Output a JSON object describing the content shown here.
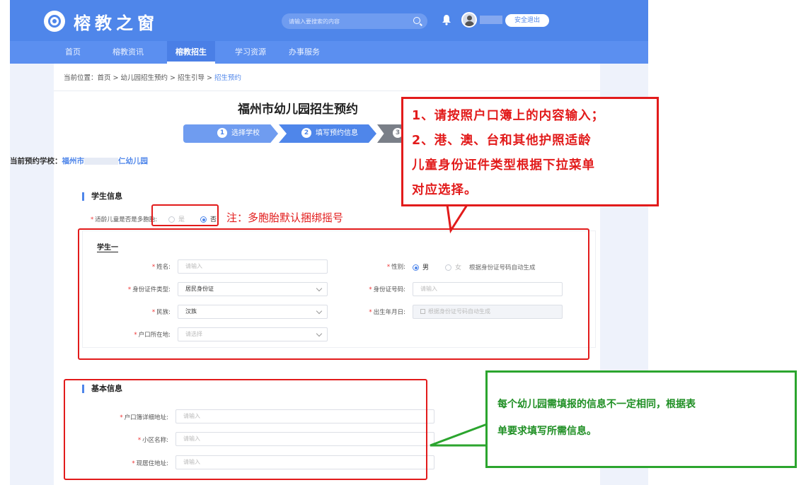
{
  "header": {
    "logo_text": "榕教之窗",
    "search_placeholder": "请输入要搜索的内容",
    "logout_label": "安全退出"
  },
  "nav": [
    "首页",
    "榕教资讯",
    "榕教招生",
    "学习资源",
    "办事服务"
  ],
  "breadcrumb": {
    "prefix": "当前位置：首页 > 幼儿园招生预约 > 招生引导 > ",
    "current": "招生预约"
  },
  "page": {
    "title": "福州市幼儿园招生预约",
    "steps": [
      {
        "num": "1",
        "label": "选择学校"
      },
      {
        "num": "2",
        "label": "填写预约信息"
      },
      {
        "num": "3",
        "label": ""
      }
    ],
    "school_label": "当前预约学校：",
    "school_name_a": "福州市",
    "school_name_b": "仁幼儿园"
  },
  "student_info": {
    "section_title": "学生信息",
    "multi_birth_label": "适龄儿童是否是多胞胎:",
    "multi_yes": "是",
    "multi_no": "否",
    "student_one": "学生一",
    "name_label": "姓名:",
    "name_placeholder": "请输入",
    "gender_label": "性别:",
    "gender_male": "男",
    "gender_female": "女",
    "gender_hint": "根据身份证号码自动生成",
    "id_type_label": "身份证件类型:",
    "id_type_value": "居民身份证",
    "id_no_label": "身份证号码:",
    "id_no_placeholder": "请输入",
    "ethnicity_label": "民族:",
    "ethnicity_value": "汉族",
    "birth_label": "出生年月日:",
    "birth_placeholder": "根据身份证号码自动生成",
    "hukou_label": "户口所在地:",
    "hukou_placeholder": "请选择"
  },
  "basic_info": {
    "section_title": "基本信息",
    "address_label": "户口簿详细地址:",
    "address_placeholder": "请输入",
    "community_label": "小区名称:",
    "community_placeholder": "请输入",
    "residence_label": "现居住地址:",
    "residence_placeholder": "请输入"
  },
  "annotations": {
    "multi_birth_note": "注：多胞胎默认捆绑摇号",
    "red_callout": [
      "1、请按照户口簿上的内容输入；",
      "2、港、澳、台和其他护照适龄",
      "儿童身份证件类型根据下拉菜单",
      "对应选择。"
    ],
    "green_callout": [
      "每个幼儿园需填报的信息不一定相同，根据表",
      "单要求填写所需信息。"
    ]
  },
  "colors": {
    "brand_blue": "#4f86ea",
    "annotation_red": "#e21b1b",
    "annotation_green": "#2ba52e"
  }
}
